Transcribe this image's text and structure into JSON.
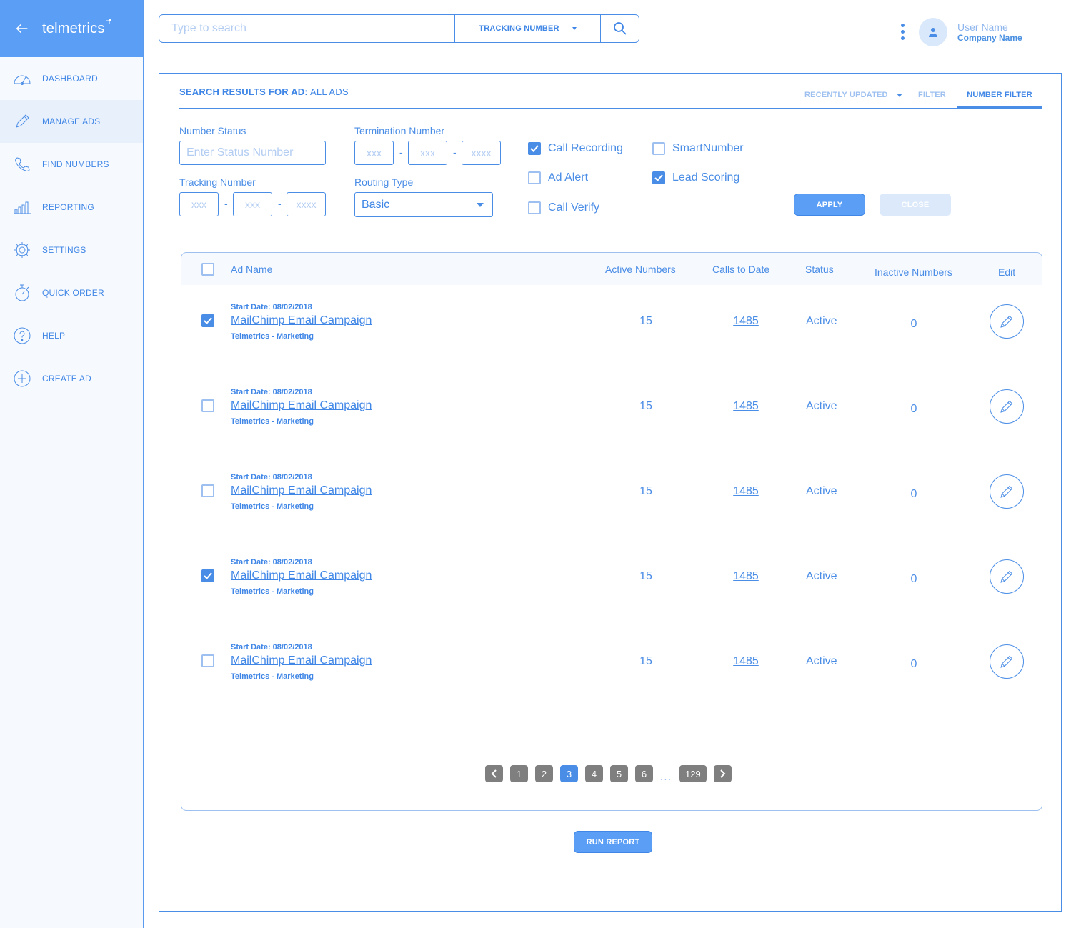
{
  "brand": {
    "logo": "telmetrics"
  },
  "sidebar": {
    "items": [
      {
        "label": "DASHBOARD",
        "icon": "dashboard-icon"
      },
      {
        "label": "MANAGE ADS",
        "icon": "pencil-icon",
        "active": true
      },
      {
        "label": "FIND NUMBERS",
        "icon": "phone-icon"
      },
      {
        "label": "REPORTING",
        "icon": "bar-chart-icon"
      },
      {
        "label": "SETTINGS",
        "icon": "gear-icon"
      },
      {
        "label": "QUICK ORDER",
        "icon": "stopwatch-icon"
      },
      {
        "label": "HELP",
        "icon": "question-icon"
      },
      {
        "label": "CREATE AD",
        "icon": "plus-circle-icon"
      }
    ]
  },
  "search": {
    "placeholder": "Type to search",
    "type_label": "TRACKING NUMBER"
  },
  "user": {
    "name": "User Name",
    "company": "Company Name"
  },
  "results": {
    "label": "SEARCH RESULTS FOR AD:",
    "value": "ALL ADS",
    "tabs": {
      "recent": "RECENTLY UPDATED",
      "filter": "FILTER",
      "number_filter": "NUMBER FILTER"
    }
  },
  "filters": {
    "number_status_label": "Number Status",
    "number_status_placeholder": "Enter Status Number",
    "termination_label": "Termination Number",
    "termination_placeholders": [
      "xxx",
      "xxx",
      "xxxx"
    ],
    "tracking_label": "Tracking Number",
    "tracking_placeholders": [
      "xxx",
      "xxx",
      "xxxx"
    ],
    "routing_label": "Routing Type",
    "routing_value": "Basic",
    "dash": "-",
    "checkboxes": [
      {
        "label": "Call Recording",
        "checked": true
      },
      {
        "label": "Ad Alert",
        "checked": false
      },
      {
        "label": "Call Verify",
        "checked": false
      },
      {
        "label": "SmartNumber",
        "checked": false
      },
      {
        "label": "Lead Scoring",
        "checked": true
      }
    ],
    "apply_label": "APPLY",
    "close_label": "CLOSE"
  },
  "table": {
    "headers": {
      "ad_name": "Ad Name",
      "active_numbers": "Active Numbers",
      "calls_to_date": "Calls to Date",
      "status": "Status",
      "inactive_numbers": "Inactive Numbers",
      "edit": "Edit"
    },
    "rows": [
      {
        "checked": true,
        "start": "Start Date: 08/02/2018",
        "name": "MailChimp Email Campaign",
        "org": "Telmetrics - Marketing",
        "active": "15",
        "calls": "1485",
        "status": "Active",
        "inactive": "0"
      },
      {
        "checked": false,
        "start": "Start Date: 08/02/2018",
        "name": "MailChimp Email Campaign",
        "org": "Telmetrics - Marketing",
        "active": "15",
        "calls": "1485",
        "status": "Active",
        "inactive": "0"
      },
      {
        "checked": false,
        "start": "Start Date: 08/02/2018",
        "name": "MailChimp Email Campaign",
        "org": "Telmetrics - Marketing",
        "active": "15",
        "calls": "1485",
        "status": "Active",
        "inactive": "0"
      },
      {
        "checked": true,
        "start": "Start Date: 08/02/2018",
        "name": "MailChimp Email Campaign",
        "org": "Telmetrics - Marketing",
        "active": "15",
        "calls": "1485",
        "status": "Active",
        "inactive": "0"
      },
      {
        "checked": false,
        "start": "Start Date: 08/02/2018",
        "name": "MailChimp Email Campaign",
        "org": "Telmetrics - Marketing",
        "active": "15",
        "calls": "1485",
        "status": "Active",
        "inactive": "0"
      }
    ]
  },
  "pagination": {
    "pages": [
      "1",
      "2",
      "3",
      "4",
      "5",
      "6"
    ],
    "current": "3",
    "ellipsis": "...",
    "last": "129"
  },
  "run_report_label": "RUN REPORT",
  "colors": {
    "accent": "#4a8de6",
    "brand": "#5a9ef5",
    "light": "#9dc0f0"
  }
}
